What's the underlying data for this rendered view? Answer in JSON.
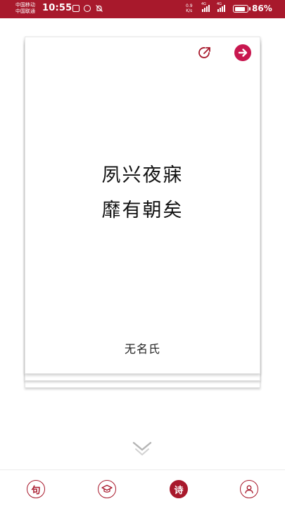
{
  "status_bar": {
    "carrier_1": "中国移动",
    "carrier_2": "中国联通",
    "time": "10:55",
    "net_speed_value": "0.9",
    "net_speed_unit": "K/s",
    "signal_1_label": "4G",
    "signal_2_label": "4G",
    "battery_percent": "86%",
    "battery_level": 0.86,
    "bar_color": "#a8192c"
  },
  "card": {
    "poem_line_1": "夙兴夜寐",
    "poem_line_2": "靡有朝矣",
    "author": "无名氏",
    "share_icon": "share-icon",
    "next_icon": "arrow-right-icon",
    "accent_color": "#c8174f"
  },
  "more_icon": "double-chevron-down-icon",
  "bottom_nav": {
    "items": [
      {
        "label": "句",
        "icon": "sentence-icon",
        "active": false
      },
      {
        "label": "",
        "icon": "graduation-cap-icon",
        "active": false
      },
      {
        "label": "诗",
        "icon": "poem-icon",
        "active": true
      },
      {
        "label": "",
        "icon": "user-icon",
        "active": false
      }
    ],
    "color": "#a8192c"
  }
}
